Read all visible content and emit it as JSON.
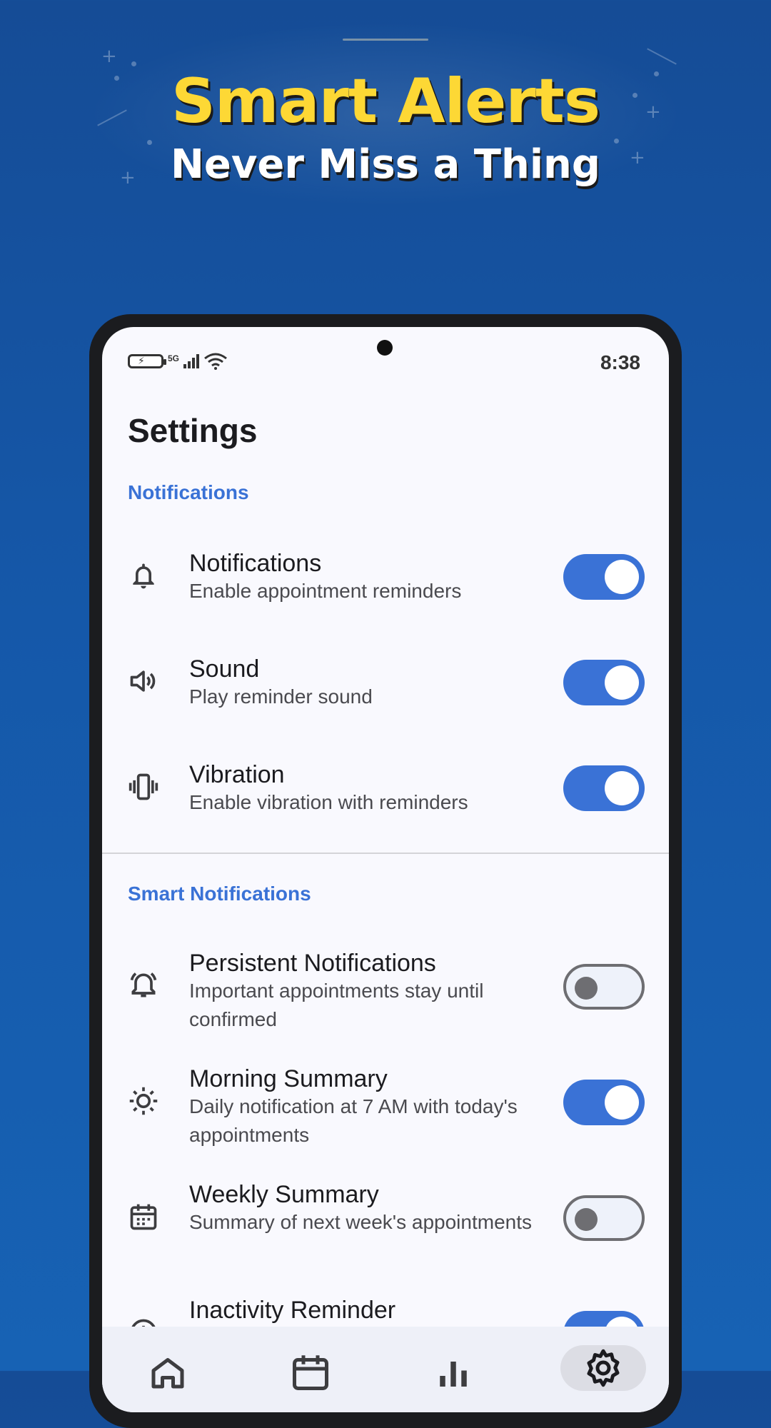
{
  "promo": {
    "headline": "Smart Alerts",
    "subheadline": "Never Miss a Thing"
  },
  "status_bar": {
    "network": "5G",
    "time": "8:38"
  },
  "page": {
    "title": "Settings"
  },
  "sections": [
    {
      "title": "Notifications",
      "items": [
        {
          "icon": "bell-icon",
          "title": "Notifications",
          "subtitle": "Enable appointment reminders",
          "enabled": true
        },
        {
          "icon": "speaker-icon",
          "title": "Sound",
          "subtitle": "Play reminder sound",
          "enabled": true
        },
        {
          "icon": "vibration-icon",
          "title": "Vibration",
          "subtitle": "Enable vibration with reminders",
          "enabled": true
        }
      ]
    },
    {
      "title": "Smart Notifications",
      "items": [
        {
          "icon": "alarm-bell-icon",
          "title": "Persistent Notifications",
          "subtitle": "Important appointments stay until confirmed",
          "enabled": false
        },
        {
          "icon": "sun-icon",
          "title": "Morning Summary",
          "subtitle": "Daily notification at 7 AM with today's appointments",
          "enabled": true
        },
        {
          "icon": "calendar-icon",
          "title": "Weekly Summary",
          "subtitle": "Summary of next week's appointments",
          "enabled": false
        },
        {
          "icon": "clock-icon",
          "title": "Inactivity Reminder",
          "subtitle": "",
          "enabled": true
        }
      ]
    }
  ],
  "bottom_nav": [
    {
      "icon": "home-icon",
      "active": false
    },
    {
      "icon": "calendar-icon",
      "active": false
    },
    {
      "icon": "bar-chart-icon",
      "active": false
    },
    {
      "icon": "gear-icon",
      "active": true
    }
  ],
  "colors": {
    "accent": "#3a72d6",
    "headline": "#fdd835",
    "background": "#1558a9"
  }
}
